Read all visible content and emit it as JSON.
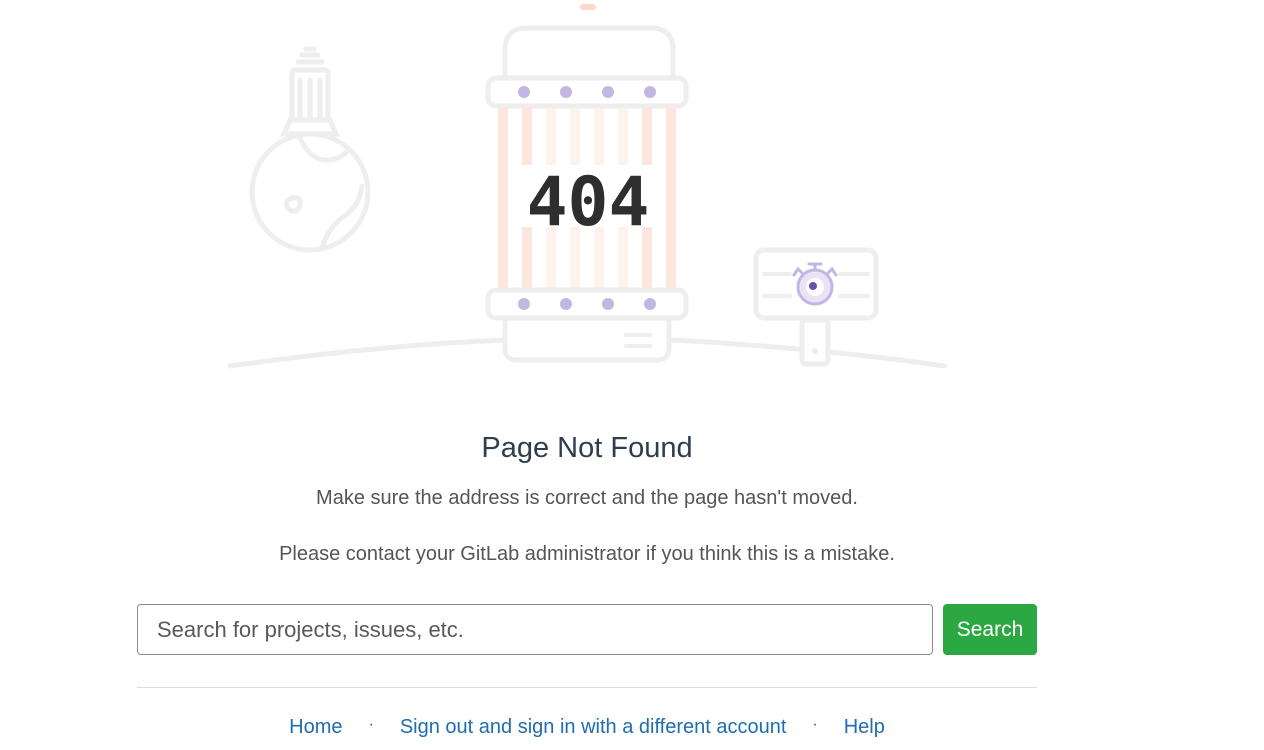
{
  "illustration": {
    "error_code": "404",
    "colors": {
      "outline": "#eeeeee",
      "dots": "#c4b6e3",
      "stripes": "#fde6dd",
      "cap": "#fdd8c8",
      "eye": "#6a4fa8"
    }
  },
  "error": {
    "title": "Page Not Found",
    "message_1": "Make sure the address is correct and the page hasn't moved.",
    "message_2": "Please contact your GitLab administrator if you think this is a mistake."
  },
  "search": {
    "placeholder": "Search for projects, issues, etc.",
    "value": "",
    "button_label": "Search",
    "button_color": "#2ca843"
  },
  "footer": {
    "links": [
      {
        "label": "Home"
      },
      {
        "label": "Sign out and sign in with a different account"
      },
      {
        "label": "Help"
      }
    ],
    "separator": "·",
    "link_color": "#1f6cb0"
  }
}
